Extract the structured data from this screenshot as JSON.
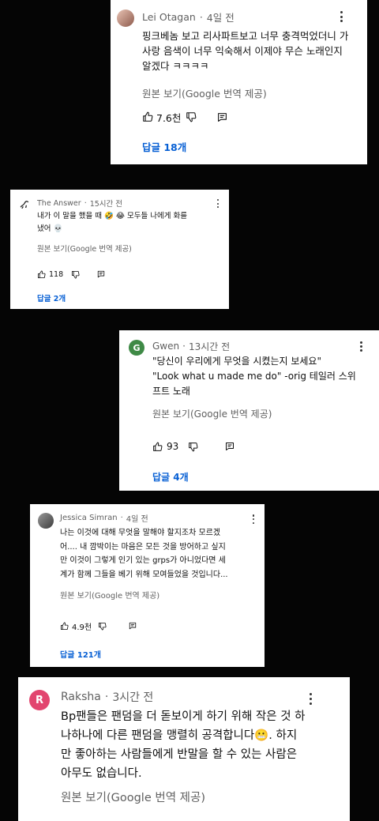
{
  "comments": [
    {
      "author": "Lei Otagan",
      "time": "4일 전",
      "lines": [
        "핑크베놈 보고 리사파트보고 너무 충격먹었더니 가",
        "사랑 음색이 너무 익숙해서 이제야 무슨 노래인지",
        "알겠다 ㅋㅋㅋㅋ"
      ],
      "translate": "원본 보기(Google 번역 제공)",
      "likes": "7.6천",
      "replies": "답글 18개"
    },
    {
      "author": "The Answer",
      "time": "15시간 전",
      "lines": [
        "내가 이 말을 했을 때 🤣 😂 모두들 나에게 화를",
        "냈어 💀"
      ],
      "translate": "원본 보기(Google 번역 제공)",
      "likes": "118",
      "replies": "답글 2개"
    },
    {
      "author": "Gwen",
      "avatar_letter": "G",
      "avatar_color": "#3f8a46",
      "time": "13시간 전",
      "lines": [
        "\"당신이 우리에게 무엇을 시켰는지 보세요\"",
        "\"Look what u made me do\" -orig 테일러 스위",
        "프트 노래"
      ],
      "translate": "원본 보기(Google 번역 제공)",
      "likes": "93",
      "replies": "답글 4개"
    },
    {
      "author": "Jessica Simran",
      "time": "4일 전",
      "lines": [
        "나는 이것에 대해 무엇을 말해야 할지조차 모르겠",
        "어.... 내 깜박이는 마음은 모든 것을 방어하고 싶지",
        "만 이것이 그렇게 인기 있는 grps가 아니었다면 세",
        "계가 함께 그들을 베기 위해 모여들었을 것입니다..."
      ],
      "translate": "원본 보기(Google 번역 제공)",
      "likes": "4.9천",
      "replies": "답글 121개"
    },
    {
      "author": "Raksha",
      "avatar_letter": "R",
      "avatar_color": "#e2456f",
      "time": "3시간 전",
      "lines": [
        "Bp팬들은 팬덤을 더 돋보이게 하기 위해 작은 것 하",
        "나하나에 다른 팬덤을 맹렬히 공격합니다😬. 하지",
        "만 좋아하는 사람들에게 반말을 할 수 있는 사람은",
        "아무도 없습니다."
      ],
      "translate": "원본 보기(Google 번역 제공)"
    }
  ]
}
